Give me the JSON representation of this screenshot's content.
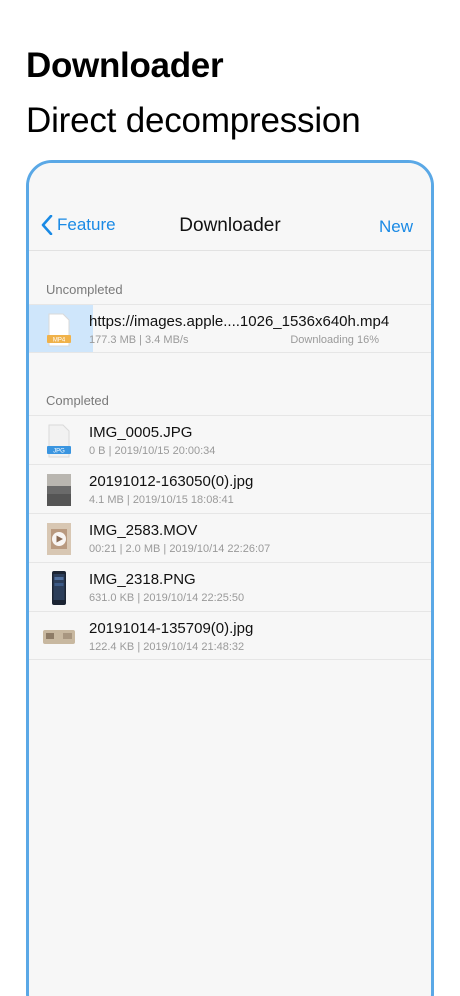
{
  "promo": {
    "title": "Downloader",
    "subtitle": "Direct decompression"
  },
  "navbar": {
    "back_label": "Feature",
    "title": "Downloader",
    "new_label": "New"
  },
  "sections": {
    "uncompleted": "Uncompleted",
    "completed": "Completed"
  },
  "uncompleted": [
    {
      "name": "https://images.apple....1026_1536x640h.mp4",
      "meta": "177.3 MB | 3.4 MB/s",
      "status": "Downloading 16%",
      "progress": 0.16,
      "icon": "mp4-file-icon",
      "badge": "MP4"
    }
  ],
  "completed": [
    {
      "name": "IMG_0005.JPG",
      "meta": "0 B | 2019/10/15 20:00:34",
      "icon": "jpg-file-icon",
      "badge": "JPG"
    },
    {
      "name": "20191012-163050(0).jpg",
      "meta": "4.1 MB | 2019/10/15 18:08:41",
      "icon": "photo-thumbnail"
    },
    {
      "name": "IMG_2583.MOV",
      "meta": "00:21 | 2.0 MB | 2019/10/14 22:26:07",
      "icon": "video-thumbnail"
    },
    {
      "name": "IMG_2318.PNG",
      "meta": "631.0 KB | 2019/10/14 22:25:50",
      "icon": "screenshot-thumbnail"
    },
    {
      "name": "20191014-135709(0).jpg",
      "meta": "122.4 KB | 2019/10/14 21:48:32",
      "icon": "photo-thumbnail"
    }
  ],
  "colors": {
    "accent": "#1a8ae5",
    "frame": "#5aa8e6",
    "progress": "#cfe6fb"
  }
}
